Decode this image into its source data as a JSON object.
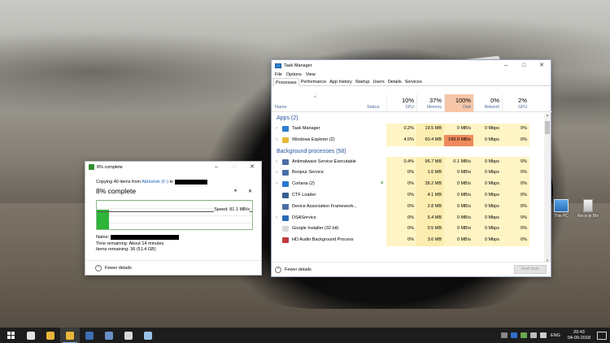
{
  "desktop": {
    "icons": [
      {
        "label": "This PC",
        "icon": "computer-icon"
      },
      {
        "label": "Recycle Bin",
        "icon": "recycle-bin-icon"
      }
    ]
  },
  "copy_dialog": {
    "title": "8% complete",
    "copying_prefix": "Copying 40 items from",
    "source": "Abhishek (F:)",
    "to_word": "to",
    "percent_label": "8% complete",
    "pause_symbol": "⏸",
    "close_symbol": "✕",
    "speed": "Speed: 81.1 MB/s",
    "progress_fraction": 0.08,
    "name_label": "Name:",
    "time_remaining": "Time remaining: About 14 minutes",
    "items_remaining": "Items remaining: 36 (51.4 GB)",
    "fewer_details": "Fewer details",
    "accent": "#2fb53a"
  },
  "task_manager": {
    "title": "Task Manager",
    "menu": [
      "File",
      "Options",
      "View"
    ],
    "tabs": [
      "Processes",
      "Performance",
      "App history",
      "Startup",
      "Users",
      "Details",
      "Services"
    ],
    "active_tab": "Processes",
    "columns": {
      "name": "Name",
      "status": "Status",
      "cpu": {
        "pct": "10%",
        "label": "CPU"
      },
      "memory": {
        "pct": "37%",
        "label": "Memory"
      },
      "disk": {
        "pct": "100%",
        "label": "Disk"
      },
      "network": {
        "pct": "0%",
        "label": "Network"
      },
      "gpu": {
        "pct": "2%",
        "label": "GPU"
      }
    },
    "groups": {
      "apps": "Apps (2)",
      "background": "Background processes (58)"
    },
    "apps": [
      {
        "name": "Task Manager",
        "cpu": "0.2%",
        "mem": "19.5 MB",
        "disk": "0 MB/s",
        "net": "0 Mbps",
        "gpu": "0%",
        "icon": "task-manager-icon",
        "color": "#2f7fd0",
        "expand": true
      },
      {
        "name": "Windows Explorer (2)",
        "cpu": "4.5%",
        "mem": "60.4 MB",
        "disk": "199.8 MB/s",
        "net": "0 Mbps",
        "gpu": "0%",
        "icon": "folder-icon",
        "color": "#e7b73a",
        "expand": true,
        "hot": true
      }
    ],
    "background": [
      {
        "name": "Antimalware Service Executable",
        "cpu": "0.4%",
        "mem": "96.7 MB",
        "disk": "0.1 MB/s",
        "net": "0 Mbps",
        "gpu": "0%",
        "icon": "service-icon",
        "color": "#4a6fa5",
        "expand": true
      },
      {
        "name": "Bonjour Service",
        "cpu": "0%",
        "mem": "1.6 MB",
        "disk": "0 MB/s",
        "net": "0 Mbps",
        "gpu": "0%",
        "icon": "service-icon",
        "color": "#4a6fa5",
        "expand": true
      },
      {
        "name": "Cortana (2)",
        "cpu": "0%",
        "mem": "38.2 MB",
        "disk": "0 MB/s",
        "net": "0 Mbps",
        "gpu": "0%",
        "icon": "cortana-icon",
        "color": "#2a7ad0",
        "expand": true,
        "leaf": true
      },
      {
        "name": "CTF Loader",
        "cpu": "0%",
        "mem": "4.1 MB",
        "disk": "0 MB/s",
        "net": "0 Mbps",
        "gpu": "0%",
        "icon": "ctf-loader-icon",
        "color": "#3b5f8f",
        "expand": false
      },
      {
        "name": "Device Association Framework...",
        "cpu": "0%",
        "mem": "2.8 MB",
        "disk": "0 MB/s",
        "net": "0 Mbps",
        "gpu": "0%",
        "icon": "service-icon",
        "color": "#4a6fa5",
        "expand": false
      },
      {
        "name": "DSAService",
        "cpu": "0%",
        "mem": "5.4 MB",
        "disk": "0 MB/s",
        "net": "0 Mbps",
        "gpu": "0%",
        "icon": "dsa-icon",
        "color": "#2a6bb8",
        "expand": true
      },
      {
        "name": "Google Installer (32 bit)",
        "cpu": "0%",
        "mem": "0.5 MB",
        "disk": "0 MB/s",
        "net": "0 Mbps",
        "gpu": "0%",
        "icon": "google-icon",
        "color": "#d9d9d9",
        "expand": false
      },
      {
        "name": "HD Audio Background Process",
        "cpu": "0%",
        "mem": "3.6 MB",
        "disk": "0 MB/s",
        "net": "0 Mbps",
        "gpu": "0%",
        "icon": "audio-icon",
        "color": "#c23b3b",
        "expand": false
      }
    ],
    "fewer_details": "Fewer details",
    "end_task": "End task",
    "hot_color": "#f08a5d"
  },
  "taskbar": {
    "apps": [
      {
        "name": "itunes",
        "color": "#e2e2e2"
      },
      {
        "name": "chrome",
        "color": "#e8b53a"
      },
      {
        "name": "file-explorer",
        "color": "#e7b73a",
        "active": true
      },
      {
        "name": "photos",
        "color": "#3d6fb5"
      },
      {
        "name": "network",
        "color": "#6a8fc8"
      },
      {
        "name": "folder",
        "color": "#d8d8d8"
      },
      {
        "name": "task-manager",
        "color": "#9bc0e8"
      }
    ],
    "language": "ENG",
    "time": "20:43",
    "date": "04-09-2018"
  }
}
